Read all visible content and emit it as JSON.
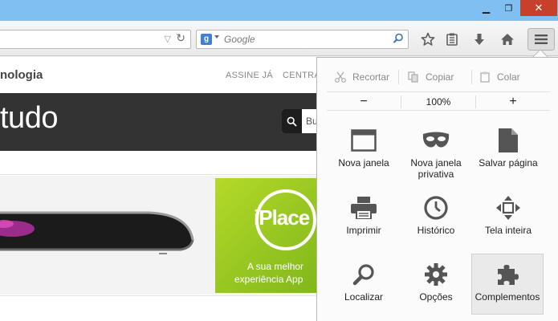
{
  "nav": {
    "search_placeholder": "Google"
  },
  "page": {
    "site_name": "nologia",
    "top_links": [
      "ASSINE JÁ",
      "CENTRA"
    ],
    "brand": "tudo",
    "search_box_text": "Bu",
    "ad": {
      "logo": "iPlace",
      "tagline_1": "A sua melhor",
      "tagline_2": "experiência App"
    }
  },
  "menu": {
    "edit": {
      "cut": "Recortar",
      "copy": "Copiar",
      "paste": "Colar"
    },
    "zoom": {
      "out": "−",
      "level": "100%",
      "in": "+"
    },
    "items": [
      {
        "label": "Nova janela",
        "icon": "window-icon"
      },
      {
        "label": "Nova janela privativa",
        "icon": "private-mask-icon"
      },
      {
        "label": "Salvar página",
        "icon": "save-page-icon"
      },
      {
        "label": "Imprimir",
        "icon": "printer-icon"
      },
      {
        "label": "Histórico",
        "icon": "history-clock-icon"
      },
      {
        "label": "Tela inteira",
        "icon": "fullscreen-icon"
      },
      {
        "label": "Localizar",
        "icon": "find-icon"
      },
      {
        "label": "Opções",
        "icon": "gear-icon"
      },
      {
        "label": "Complementos",
        "icon": "puzzle-icon"
      }
    ]
  },
  "colors": {
    "titlebar": "#7fbff2",
    "close": "#c7402b",
    "ad_green": "#9ccc22"
  }
}
